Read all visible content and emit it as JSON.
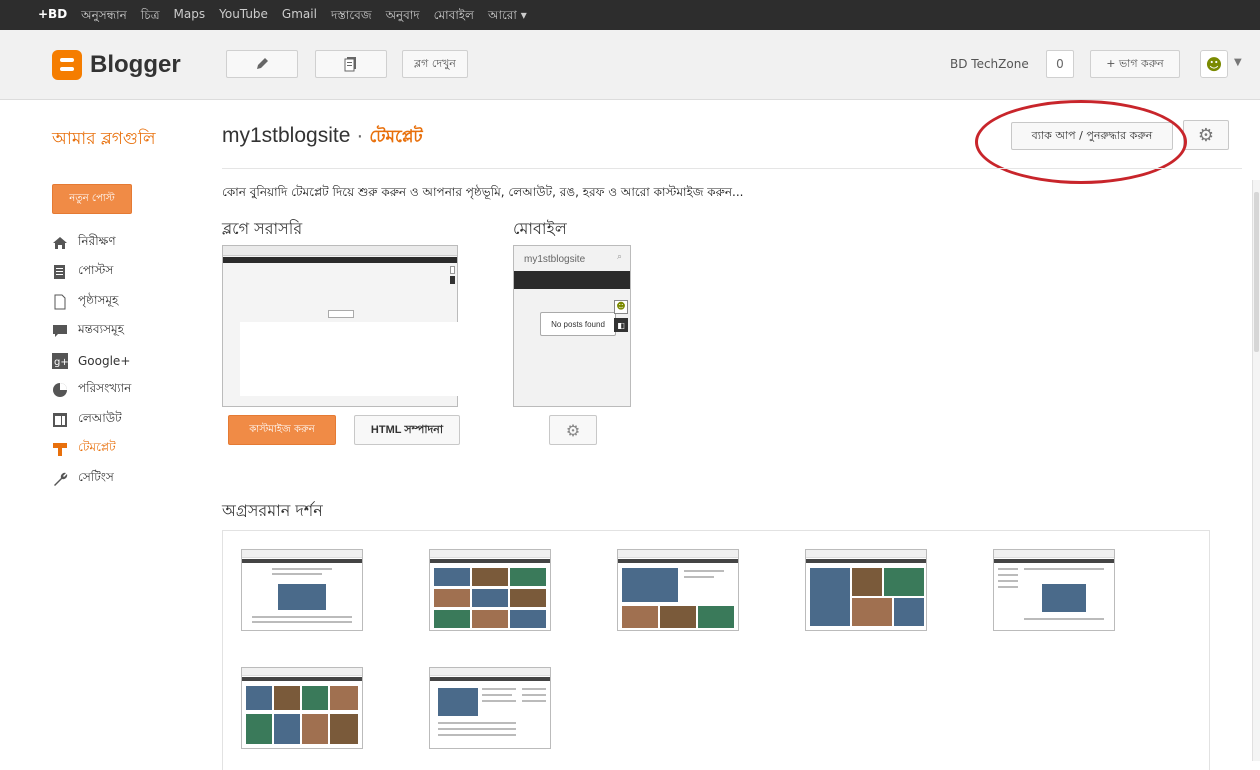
{
  "google_bar": {
    "items": [
      "+BD",
      "অনুসন্ধান",
      "চিত্র",
      "Maps",
      "YouTube",
      "Gmail",
      "দস্তাবেজ",
      "অনুবাদ",
      "মোবাইল",
      "আরো ▾"
    ]
  },
  "header": {
    "logo_text": "Blogger",
    "view_blog_label": "ব্লগ দেখুন",
    "account_name": "BD TechZone",
    "notification_count": "0",
    "share_label": "+ ভাগ করুন"
  },
  "title_row": {
    "my_blogs": "আমার ব্লগগুলি",
    "blog_name": "my1stblogsite",
    "separator": "·",
    "current_section": "টেমপ্লেট",
    "backup_label": "ব্যাক আপ / পুনরুদ্ধার করুন"
  },
  "sidebar": {
    "new_post_label": "নতুন পোস্ট",
    "items": [
      {
        "label": "নিরীক্ষণ",
        "icon": "home-icon"
      },
      {
        "label": "পোস্টস",
        "icon": "posts-icon"
      },
      {
        "label": "পৃষ্ঠাসমূহ",
        "icon": "pages-icon"
      },
      {
        "label": "মন্তব্যসমূহ",
        "icon": "comments-icon"
      },
      {
        "label": "Google+",
        "icon": "google-plus-icon"
      },
      {
        "label": "পরিসংখ্যান",
        "icon": "stats-icon"
      },
      {
        "label": "লেআউট",
        "icon": "layout-icon"
      },
      {
        "label": "টেমপ্লেট",
        "icon": "template-icon",
        "active": true
      },
      {
        "label": "সেটিংস",
        "icon": "wrench-icon"
      }
    ]
  },
  "main": {
    "intro_text": "কোন বুনিয়াদি টেমপ্লেট দিয়ে শুরু করুন ও আপনার পৃষ্ঠভূমি, লেআউট, রঙ, হরফ ও আরো কাস্টমাইজ করুন...",
    "live_heading": "ব্লগে সরাসরি",
    "mobile_heading": "মোবাইল",
    "mobile_preview_title": "my1stblogsite",
    "mobile_no_posts": "No posts found",
    "customize_label": "কাস্টমাইজ করুন",
    "edit_html_label": "HTML সম্পাদনা",
    "advanced_heading": "অগ্রসরমান দর্শন"
  },
  "colors": {
    "accent": "#e8700c",
    "button_orange": "#f08b46",
    "annotation_red": "#c8252b",
    "topbar": "#2d2d2d"
  }
}
